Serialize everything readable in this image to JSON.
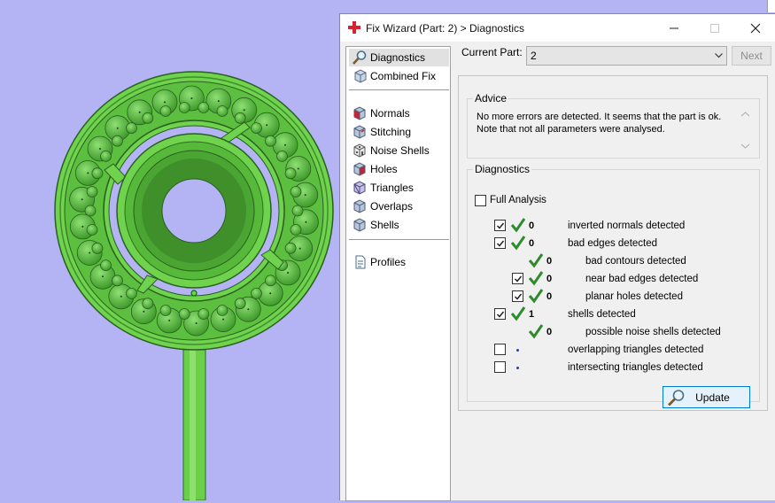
{
  "title_bar": {
    "title": "Fix Wizard (Part: 2) > Diagnostics"
  },
  "nav": {
    "items": [
      {
        "label": "Diagnostics",
        "icon": "magnifier-icon",
        "selected": true
      },
      {
        "label": "Combined Fix",
        "icon": "cube-icon"
      },
      {
        "label": "Normals",
        "icon": "normals-cube-icon"
      },
      {
        "label": "Stitching",
        "icon": "stitching-cube-icon"
      },
      {
        "label": "Noise Shells",
        "icon": "dice-icon"
      },
      {
        "label": "Holes",
        "icon": "holes-cube-icon"
      },
      {
        "label": "Triangles",
        "icon": "triangles-cube-icon"
      },
      {
        "label": "Overlaps",
        "icon": "overlaps-cube-icon"
      },
      {
        "label": "Shells",
        "icon": "shells-cube-icon"
      },
      {
        "label": "Profiles",
        "icon": "document-icon"
      }
    ]
  },
  "header": {
    "current_part_label": "Current Part:",
    "current_part_value": "2",
    "next_label": "Next"
  },
  "advice": {
    "title": "Advice",
    "line1": "No more errors are detected. It seems that the part is ok.",
    "line2": "Note that not all parameters were analysed."
  },
  "diagnostics": {
    "title": "Diagnostics",
    "full_analysis_label": "Full Analysis",
    "full_analysis_checked": false,
    "rows": [
      {
        "checkbox": true,
        "checked": true,
        "status": "ok",
        "count": "0",
        "label": "inverted normals detected",
        "indent": 0
      },
      {
        "checkbox": true,
        "checked": true,
        "status": "ok",
        "count": "0",
        "label": "bad edges detected",
        "indent": 0
      },
      {
        "checkbox": false,
        "checked": false,
        "status": "ok",
        "count": "0",
        "label": "bad contours detected",
        "indent": 1
      },
      {
        "checkbox": true,
        "checked": true,
        "status": "ok",
        "count": "0",
        "label": "near bad edges detected",
        "indent": 1
      },
      {
        "checkbox": true,
        "checked": true,
        "status": "ok",
        "count": "0",
        "label": "planar holes detected",
        "indent": 1
      },
      {
        "checkbox": true,
        "checked": true,
        "status": "ok",
        "count": "1",
        "label": "shells detected",
        "indent": 0
      },
      {
        "checkbox": false,
        "checked": false,
        "status": "ok",
        "count": "0",
        "label": "possible noise shells detected",
        "indent": 1
      },
      {
        "checkbox": true,
        "checked": false,
        "status": "none",
        "count": "",
        "label": "overlapping triangles detected",
        "indent": 0
      },
      {
        "checkbox": true,
        "checked": false,
        "status": "none",
        "count": "",
        "label": "intersecting triangles detected",
        "indent": 0
      }
    ],
    "update_label": "Update"
  },
  "colors": {
    "viewport_bg": "#b4b4f4",
    "model_green": "#6fd34e",
    "check_green": "#2e8b2e",
    "accent_blue": "#0078d7"
  }
}
